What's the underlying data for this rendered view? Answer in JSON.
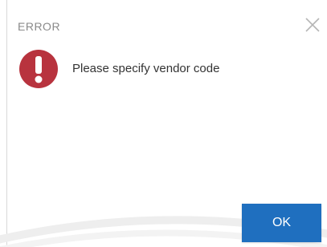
{
  "dialog": {
    "title": "ERROR",
    "message": "Please specify vendor code",
    "ok_label": "OK",
    "close_icon": "close-icon",
    "status_icon": "error-icon"
  },
  "colors": {
    "accent": "#1f6fbf",
    "error": "#b8333e",
    "title_text": "#8a8a8a",
    "message_text": "#333333"
  }
}
